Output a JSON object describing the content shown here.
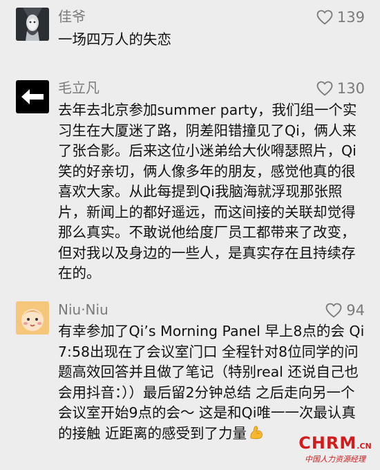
{
  "comments": [
    {
      "name": "佳爷",
      "likes": "139",
      "avatar_icon": "dark-portrait-avatar",
      "text": "一场四万人的失恋"
    },
    {
      "name": "毛立凡",
      "likes": "130",
      "avatar_icon": "left-arrow-avatar",
      "text": "去年去北京参加summer party，我们组一个实习生在大厦迷了路，阴差阳错撞见了Qi，俩人来了张合影。后来这位小迷弟给大伙嘚瑟照片，Qi笑的好亲切，俩人像多年的朋友，感觉他真的很喜欢大家。从此每提到Qi我脑海就浮现那张照片，新闻上的都好遥远，而这间接的关联却觉得那么真实。不敢说他给度厂员工都带来了改变，但对我以及身边的一些人，是真实存在且持续存在的。"
    },
    {
      "name": "Niu·Niu",
      "likes": "94",
      "avatar_icon": "cartoon-baby-avatar",
      "text": "有幸参加了Qi’s Morning Panel  早上8点的会 Qi 7:58出现在了会议室门口 全程针对8位同学的问题高效回答并且做了笔记（特别real 还说自己也会用抖音：））最后留2分钟总结 之后走向另一个会议室开始9点的会～ 这是和Qi唯一一次最认真的接触  近距离的感受到了力量"
    }
  ],
  "watermark": {
    "brand": "CHRM",
    "suffix": ".CN",
    "tagline": "中国人力资源经理"
  },
  "colors": {
    "background": "#ededed",
    "meta_text": "#7a7a7a",
    "body_text": "#111111",
    "watermark": "#d21c1c"
  }
}
